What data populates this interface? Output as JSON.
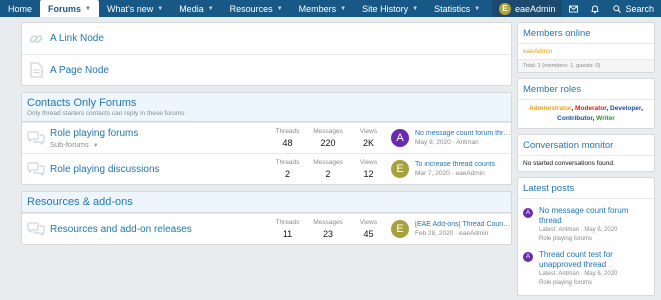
{
  "nav": {
    "items": [
      {
        "label": "Home",
        "caret": false,
        "active": false
      },
      {
        "label": "Forums",
        "caret": true,
        "active": true
      },
      {
        "label": "What's new",
        "caret": true,
        "active": false
      },
      {
        "label": "Media",
        "caret": true,
        "active": false
      },
      {
        "label": "Resources",
        "caret": true,
        "active": false
      },
      {
        "label": "Members",
        "caret": true,
        "active": false
      },
      {
        "label": "Site History",
        "caret": true,
        "active": false
      },
      {
        "label": "Statistics",
        "caret": true,
        "active": false
      }
    ],
    "user": {
      "initial": "E",
      "name": "eaeAdmin"
    },
    "search_label": "Search"
  },
  "top_nodes": [
    {
      "title": "A Link Node",
      "icon": "link-icon"
    },
    {
      "title": "A Page Node",
      "icon": "page-icon"
    }
  ],
  "categories": [
    {
      "title": "Contacts Only Forums",
      "desc": "Only thread starters contacts can reply in these forums",
      "forums": [
        {
          "title": "Role playing forums",
          "sub": "Sub-forums",
          "threads": "48",
          "messages": "220",
          "views": "2K",
          "last_title": "No message count forum thread",
          "last_date": "May 8, 2020",
          "last_user": "Antman",
          "avatar_initial": "A",
          "avatar_color": "#6a2bad"
        },
        {
          "title": "Role playing discussions",
          "sub": "",
          "threads": "2",
          "messages": "2",
          "views": "12",
          "last_title": "To increase thread counts",
          "last_date": "Mar 7, 2020",
          "last_user": "eaeAdmin",
          "avatar_initial": "E",
          "avatar_color": "#a5a23e"
        }
      ]
    },
    {
      "title": "Resources & add-ons",
      "desc": "",
      "forums": [
        {
          "title": "Resources and add-on releases",
          "sub": "",
          "threads": "11",
          "messages": "23",
          "views": "45",
          "last_title": "[EAE Add-ons] Thread Count [Paid]",
          "last_date": "Feb 28, 2020",
          "last_user": "eaeAdmin",
          "avatar_initial": "E",
          "avatar_color": "#a5a23e"
        }
      ]
    }
  ],
  "labels": {
    "threads": "Threads",
    "messages": "Messages",
    "views": "Views"
  },
  "sidebar": {
    "members_online": {
      "title": "Members online",
      "member": "eaeAdmin",
      "footer": "Total: 1 (members: 1, guests: 0)"
    },
    "member_roles": {
      "title": "Member roles",
      "roles": [
        {
          "name": "Administrator",
          "color": "#e8a30f"
        },
        {
          "name": "Moderator",
          "color": "#d11d1d"
        },
        {
          "name": "Developer",
          "color": "#1d4ea0"
        },
        {
          "name": "Contributor",
          "color": "#1d4ea0"
        },
        {
          "name": "Writer",
          "color": "#2e9a2e"
        }
      ]
    },
    "conversation": {
      "title": "Conversation monitor",
      "text": "No started conversations found."
    },
    "latest_posts": {
      "title": "Latest posts",
      "posts": [
        {
          "title": "No message count forum thread",
          "meta": "Latest: Antman · May 8, 2020",
          "forum": "Role playing forums",
          "initial": "A",
          "color": "#6a2bad"
        },
        {
          "title": "Thread count test for unapproved thread",
          "meta": "Latest: Antman · May 8, 2020",
          "forum": "Role playing forums",
          "initial": "A",
          "color": "#6a2bad"
        }
      ]
    }
  }
}
